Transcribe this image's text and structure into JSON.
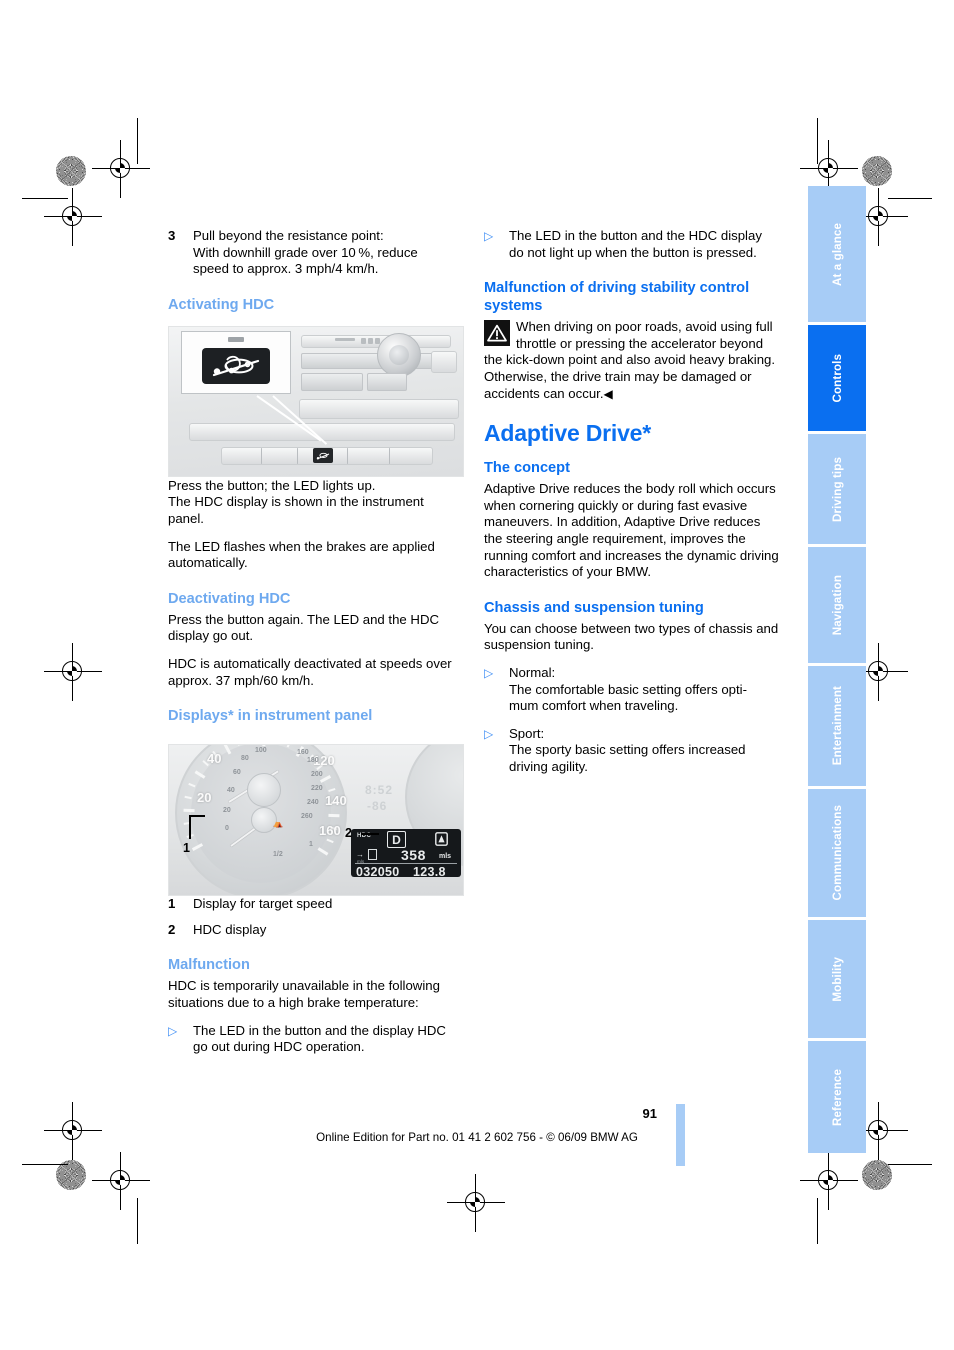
{
  "document": {
    "page_number": "91",
    "footer": "Online Edition for Part no. 01 41 2 602 756 - © 06/09 BMW AG"
  },
  "left_column": {
    "step": {
      "number": "3",
      "text": "Pull beyond the resistance point:\nWith downhill grade over 10 %, reduce speed to approx. 3 mph/4 km/h."
    },
    "heading_activating": "Activating HDC",
    "para_press_button": "Press the button; the LED lights up.\nThe HDC display is shown in the instrument panel.",
    "para_led_flashes": "The LED flashes when the brakes are applied automatically.",
    "heading_deactivating": "Deactivating HDC",
    "para_press_again": "Press the button again. The LED and the HDC display go out.",
    "para_auto_deactivate": "HDC is automatically deactivated at speeds over approx. 37 mph/60 km/h.",
    "heading_displays": "Displays* in instrument panel",
    "legend": [
      {
        "number": "1",
        "text": "Display for target speed"
      },
      {
        "number": "2",
        "text": "HDC display"
      }
    ],
    "heading_malfunction": "Malfunction",
    "para_malfunction": "HDC is temporarily unavailable in the following situations due to a high brake temperature:",
    "bullet_malfunction": "The LED in the button and the display HDC go out during HDC operation."
  },
  "right_column": {
    "bullet_led_no_light": "The LED in the button and the HDC display do not light up when the button is pressed.",
    "heading_malfunction_stability": "Malfunction of driving stability control systems",
    "warning_text": "When driving on poor roads, avoid using full throttle or pressing the accelerator beyond the kick-down point and also avoid heavy braking. Otherwise, the drive train may be damaged or accidents can occur.",
    "warning_end_mark": "◀",
    "title_adaptive_drive": "Adaptive Drive*",
    "heading_concept": "The concept",
    "para_concept": "Adaptive Drive reduces the body roll which occurs when cornering quickly or during fast evasive maneuvers. In addition, Adaptive Drive reduces the steering angle requirement, improves the running comfort and increases the dynamic driving characteristics of your BMW.",
    "heading_chassis": "Chassis and suspension tuning",
    "para_chassis": "You can choose between two types of chassis and suspension tuning.",
    "bullets_chassis": [
      {
        "label": "Normal:",
        "text": "The comfortable basic setting offers optimum comfort when traveling."
      },
      {
        "label": "Sport:",
        "text": "The sporty basic setting offers increased driving agility."
      }
    ]
  },
  "figures": {
    "console": {
      "caption_credit": "",
      "hdc_button_label": "HDC button"
    },
    "cluster": {
      "caption_credit": "",
      "speed_numbers_mph": [
        "20",
        "40",
        "120",
        "140",
        "160"
      ],
      "speed_numbers_kmh": [
        "20",
        "40",
        "60",
        "80",
        "100",
        "160",
        "180",
        "200",
        "220",
        "240",
        "260"
      ],
      "fuel_marks": [
        "0",
        "1/2",
        "1"
      ],
      "clock": "8:52",
      "temperature": "-86",
      "lcd_hdc_label": "HDC",
      "lcd_gear": "D",
      "lcd_range": "358",
      "lcd_range_unit": "mls",
      "lcd_odometer": "032050",
      "lcd_trip": "123.8",
      "lcd_trip_unit": "mls",
      "callout_1": "1",
      "callout_2": "2"
    }
  },
  "sidebar": {
    "tabs": [
      {
        "label": "At a glance",
        "active": false
      },
      {
        "label": "Controls",
        "active": true
      },
      {
        "label": "Driving tips",
        "active": false
      },
      {
        "label": "Navigation",
        "active": false
      },
      {
        "label": "Entertainment",
        "active": false
      },
      {
        "label": "Communications",
        "active": false
      },
      {
        "label": "Mobility",
        "active": false
      },
      {
        "label": "Reference",
        "active": false
      }
    ]
  },
  "colors": {
    "accent_blue": "#0a6ff0",
    "soft_blue": "#6ea9ef",
    "tab_inactive": "#a7ccf6"
  }
}
